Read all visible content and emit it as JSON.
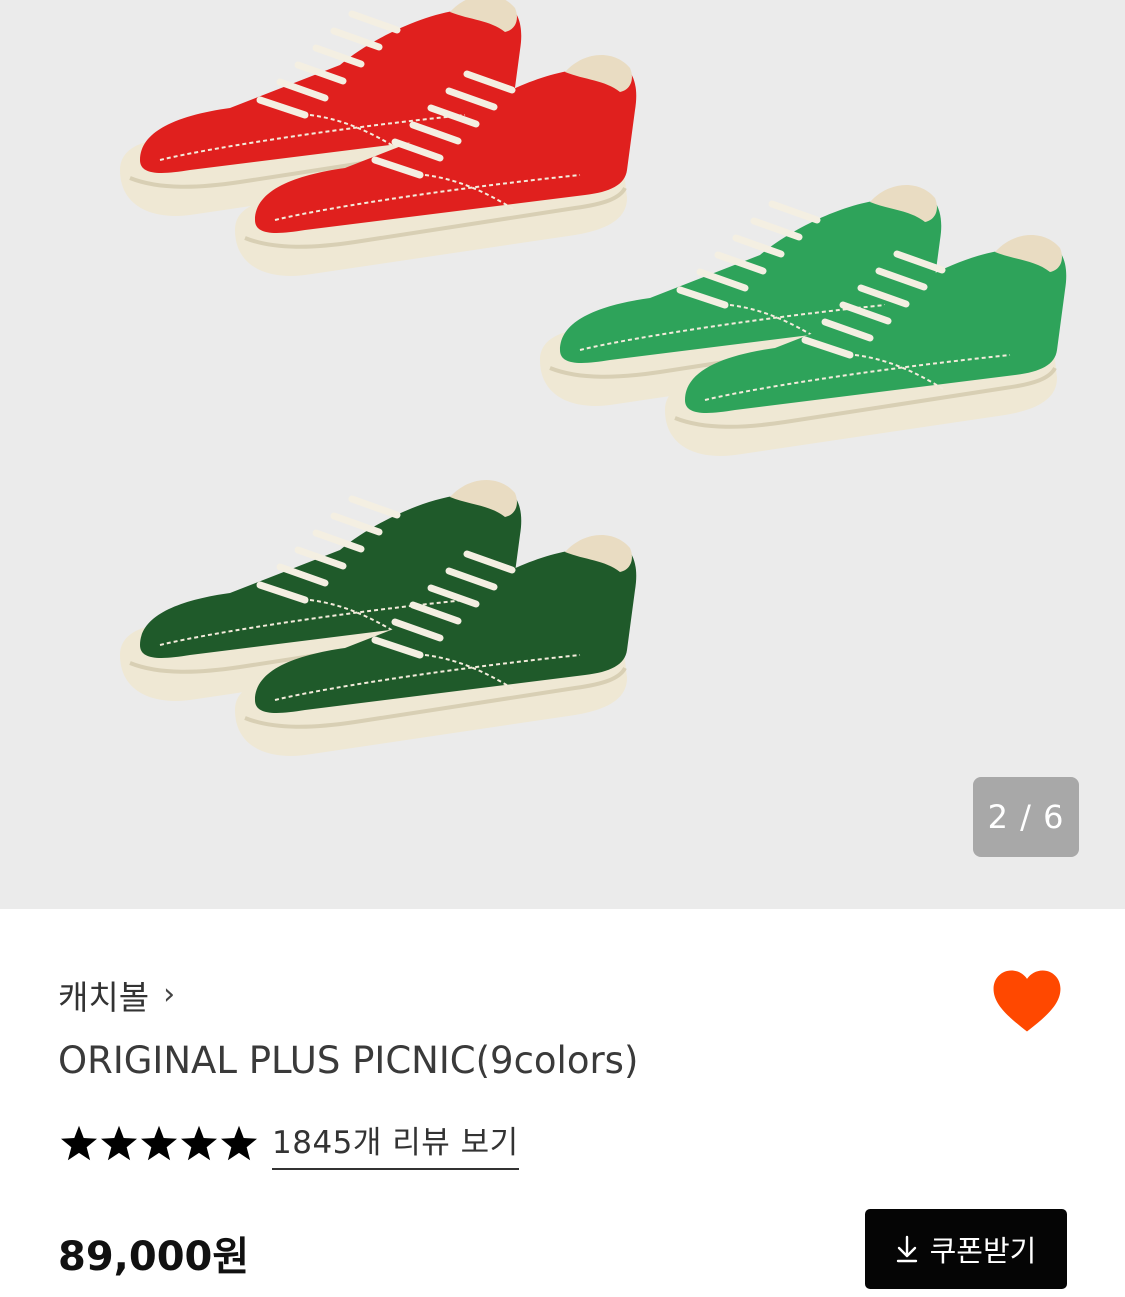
{
  "gallery": {
    "current_page": "2 / 6",
    "image": "shoe-color-variants-red-green-darkgreen"
  },
  "product": {
    "brand": "캐치볼",
    "brand_chevron": "›",
    "title": "ORIGINAL PLUS PICNIC(9colors)",
    "rating": 5,
    "review_link": "1845개 리뷰 보기",
    "price": "89,000원",
    "liked": true
  },
  "actions": {
    "coupon_label": "쿠폰받기",
    "coupon_icon": "download-icon"
  },
  "colors": {
    "like": "#ff4800",
    "button_bg": "#050505",
    "shoe_red": "#e0201e",
    "shoe_green": "#2ea35a",
    "shoe_darkgreen": "#1f5a2a"
  }
}
